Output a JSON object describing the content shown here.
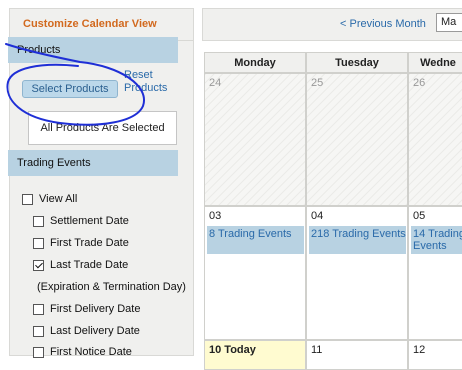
{
  "sidebar": {
    "title": "Customize Calendar View",
    "products": {
      "heading": "Products",
      "select_button": "Select Products",
      "reset_link": "Reset Products",
      "selection_status": "All Products Are Selected"
    },
    "trading_events": {
      "heading": "Trading Events",
      "items": [
        {
          "label": "View All",
          "checked": false
        },
        {
          "label": "Settlement Date",
          "checked": false
        },
        {
          "label": "First Trade Date",
          "checked": false
        },
        {
          "label": "Last Trade Date",
          "checked": true
        },
        {
          "label": "(Expiration & Termination Day)",
          "checked": null
        },
        {
          "label": "First Delivery Date",
          "checked": false
        },
        {
          "label": "Last Delivery Date",
          "checked": false
        },
        {
          "label": "First Notice Date",
          "checked": false
        }
      ]
    }
  },
  "calendar": {
    "prev_link": "< Previous Month",
    "month_select_value": "Ma",
    "day_headers": [
      "Monday",
      "Tuesday",
      "Wedne"
    ],
    "weeks": [
      [
        {
          "day": "24",
          "past": true
        },
        {
          "day": "25",
          "past": true
        },
        {
          "day": "26",
          "past": true
        }
      ],
      [
        {
          "day": "03",
          "event": "8 Trading Events"
        },
        {
          "day": "04",
          "event": "218 Trading Events"
        },
        {
          "day": "05",
          "event": "14 Trading Events"
        }
      ],
      [
        {
          "day": "10",
          "today_label": "10 Today"
        },
        {
          "day": "11"
        },
        {
          "day": "12"
        }
      ]
    ]
  },
  "colors": {
    "accent_orange": "#d2691e",
    "section_blue": "#b8d2e2",
    "link_blue": "#2a6aa9",
    "annotation_ink": "#1f2fd6",
    "today_highlight": "#fffbd0"
  }
}
